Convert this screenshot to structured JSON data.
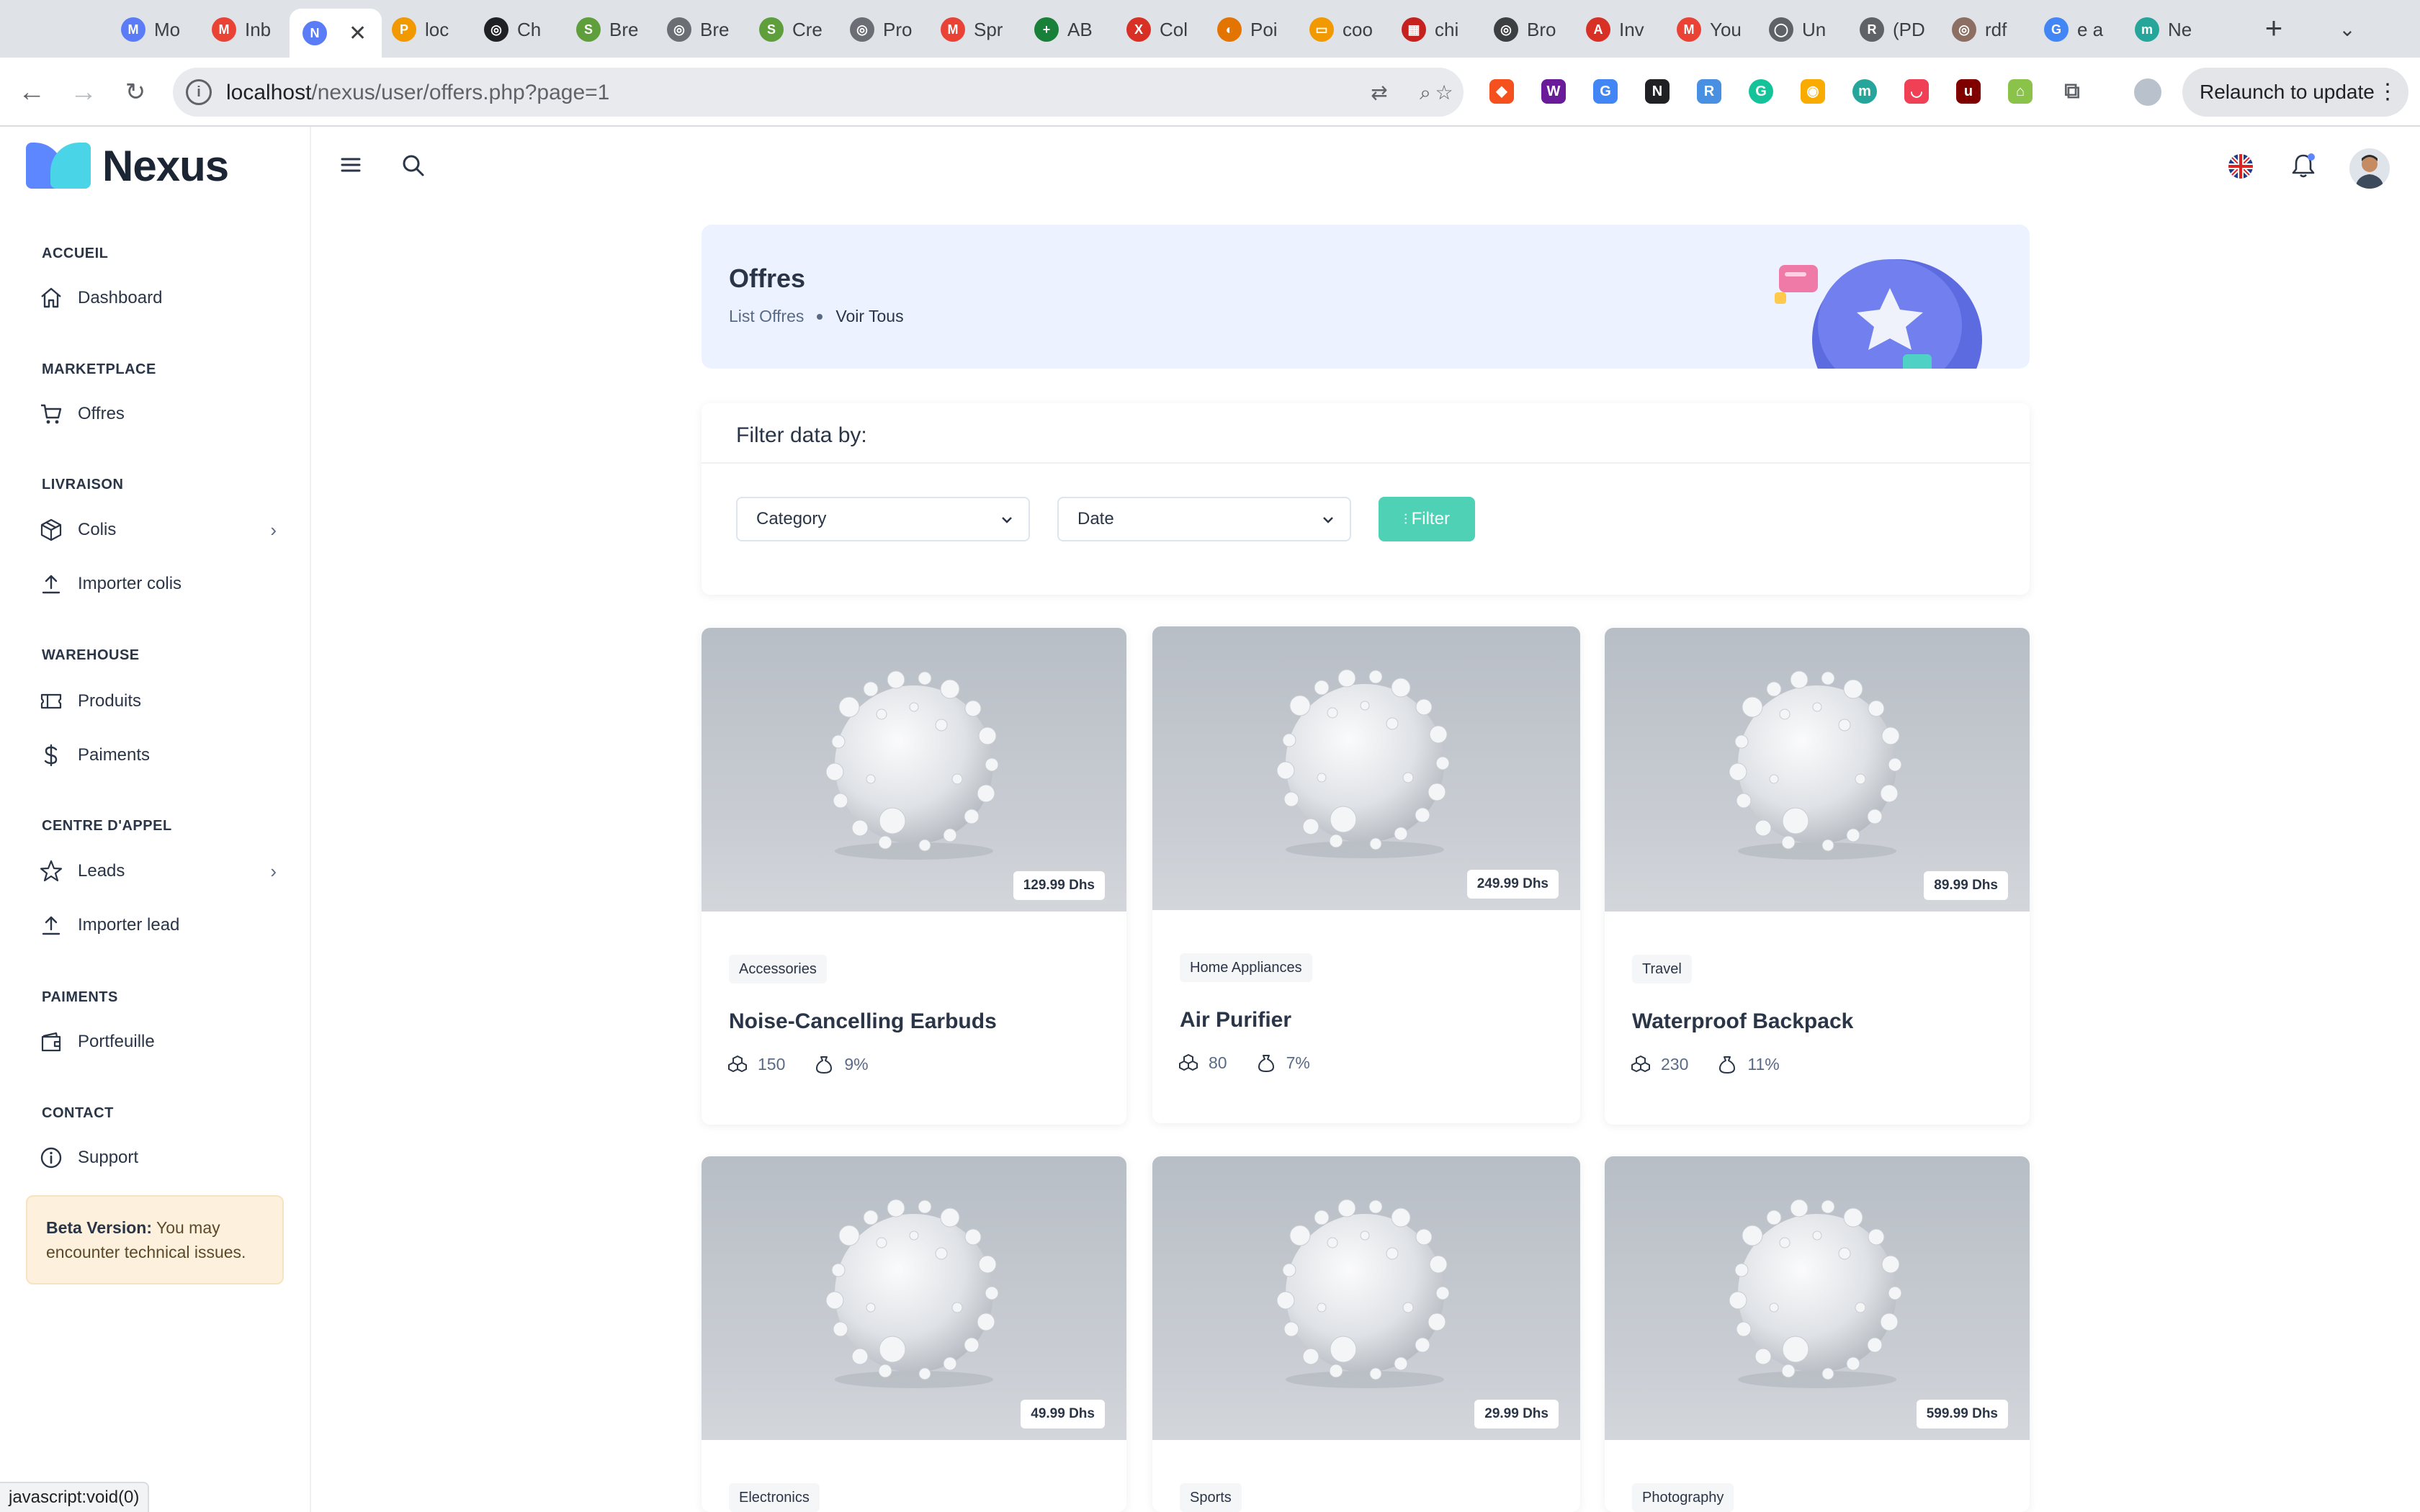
{
  "browser": {
    "tabs": [
      {
        "title": "Mo",
        "color": "#5b7cf7",
        "glyph": "M"
      },
      {
        "title": "Inb",
        "color": "#ea4335",
        "glyph": "M"
      },
      {
        "title": "",
        "color": "#5b7cf7",
        "glyph": "N",
        "active": true
      },
      {
        "title": "loc",
        "color": "#f29900",
        "glyph": "P"
      },
      {
        "title": "Ch",
        "color": "#202124",
        "glyph": "◎"
      },
      {
        "title": "Bre",
        "color": "#5e9e3b",
        "glyph": "S"
      },
      {
        "title": "Bre",
        "color": "#6b6f75",
        "glyph": "◎"
      },
      {
        "title": "Cre",
        "color": "#5e9e3b",
        "glyph": "S"
      },
      {
        "title": "Pro",
        "color": "#6b6f75",
        "glyph": "◎"
      },
      {
        "title": "Spr",
        "color": "#ea4335",
        "glyph": "M"
      },
      {
        "title": "AB",
        "color": "#188038",
        "glyph": "+"
      },
      {
        "title": "Col",
        "color": "#d93025",
        "glyph": "X"
      },
      {
        "title": "Poi",
        "color": "#e37400",
        "glyph": "◐"
      },
      {
        "title": "coo",
        "color": "#f29900",
        "glyph": "▭"
      },
      {
        "title": "chi",
        "color": "#c5221f",
        "glyph": "▦"
      },
      {
        "title": "Bro",
        "color": "#3c4043",
        "glyph": "◎"
      },
      {
        "title": "Inv",
        "color": "#d93025",
        "glyph": "A"
      },
      {
        "title": "You",
        "color": "#ea4335",
        "glyph": "M"
      },
      {
        "title": "Un",
        "color": "#5f6368",
        "glyph": "◯"
      },
      {
        "title": "(PD",
        "color": "#5f6368",
        "glyph": "R"
      },
      {
        "title": "rdf",
        "color": "#8d6e63",
        "glyph": "◎"
      },
      {
        "title": "e a",
        "color": "#4285f4",
        "glyph": "G"
      },
      {
        "title": "Ne",
        "color": "#26a69a",
        "glyph": "m"
      }
    ],
    "url_host": "localhost",
    "url_path": "/nexus/user/offers.php?page=1",
    "relaunch_label": "Relaunch to update",
    "status_text": "javascript:void(0)"
  },
  "app": {
    "logo_text": "Nexus",
    "sidebar": {
      "sections": [
        {
          "title": "ACCUEIL",
          "items": [
            {
              "label": "Dashboard",
              "icon": "home-icon"
            }
          ]
        },
        {
          "title": "MARKETPLACE",
          "items": [
            {
              "label": "Offres",
              "icon": "cart-icon"
            }
          ]
        },
        {
          "title": "LIVRAISON",
          "items": [
            {
              "label": "Colis",
              "icon": "box-icon",
              "expand": true
            },
            {
              "label": "Importer colis",
              "icon": "upload-icon"
            }
          ]
        },
        {
          "title": "WAREHOUSE",
          "items": [
            {
              "label": "Produits",
              "icon": "ticket-icon"
            },
            {
              "label": "Paiments",
              "icon": "dollar-icon"
            }
          ]
        },
        {
          "title": "CENTRE D'APPEL",
          "items": [
            {
              "label": "Leads",
              "icon": "star-icon",
              "expand": true
            },
            {
              "label": "Importer lead",
              "icon": "upload-icon"
            }
          ]
        },
        {
          "title": "PAIMENTS",
          "items": [
            {
              "label": "Portfeuille",
              "icon": "wallet-icon"
            }
          ]
        },
        {
          "title": "CONTACT",
          "items": [
            {
              "label": "Support",
              "icon": "info-icon"
            }
          ]
        }
      ],
      "beta_bold": "Beta Version:",
      "beta_text": " You may encounter technical issues."
    },
    "hero": {
      "title": "Offres",
      "crumb_parent": "List Offres",
      "crumb_current": "Voir Tous"
    },
    "filter": {
      "heading": "Filter data by:",
      "category_placeholder": "Category",
      "date_placeholder": "Date",
      "button_label": "Filter"
    },
    "offers": [
      {
        "price": "129.99 Dhs",
        "category": "Accessories",
        "name": "Noise-Cancelling Earbuds",
        "stock": "150",
        "commission": "9%"
      },
      {
        "price": "249.99 Dhs",
        "category": "Home Appliances",
        "name": "Air Purifier",
        "stock": "80",
        "commission": "7%"
      },
      {
        "price": "89.99 Dhs",
        "category": "Travel",
        "name": "Waterproof Backpack",
        "stock": "230",
        "commission": "11%"
      },
      {
        "price": "49.99 Dhs",
        "category": "Electronics",
        "name": "",
        "stock": "",
        "commission": ""
      },
      {
        "price": "29.99 Dhs",
        "category": "Sports",
        "name": "",
        "stock": "",
        "commission": ""
      },
      {
        "price": "599.99 Dhs",
        "category": "Photography",
        "name": "",
        "stock": "",
        "commission": ""
      }
    ]
  }
}
